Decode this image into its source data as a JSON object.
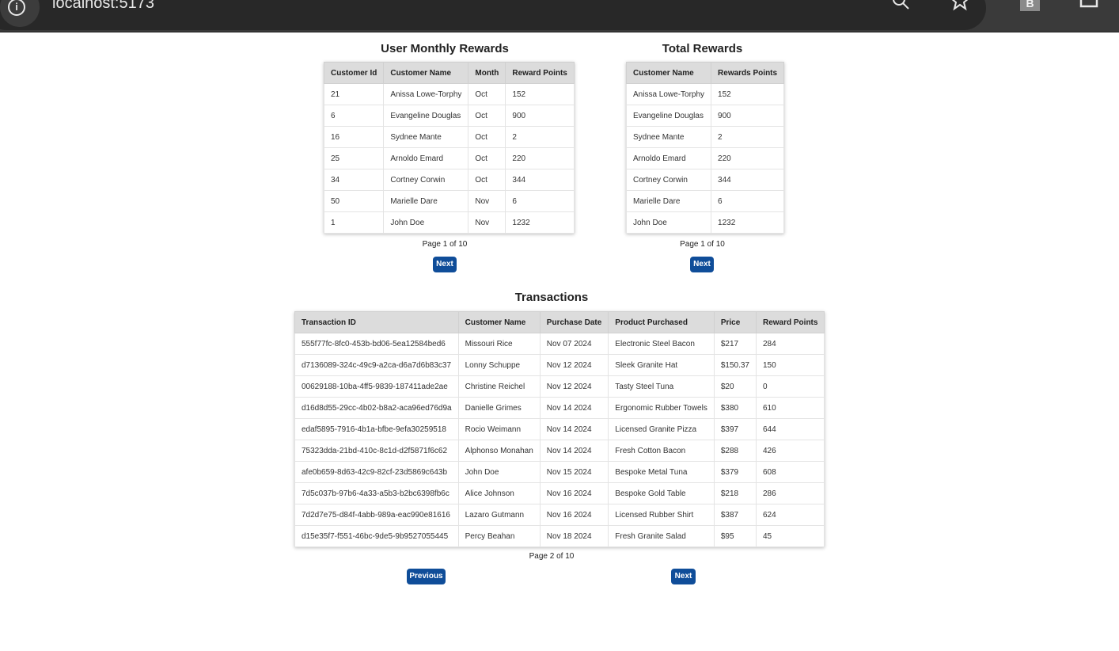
{
  "browser": {
    "url": "localhost:5173",
    "profile_initial": "B"
  },
  "monthly": {
    "title": "User Monthly Rewards",
    "headers": [
      "Customer Id",
      "Customer Name",
      "Month",
      "Reward Points"
    ],
    "rows": [
      [
        "21",
        "Anissa Lowe-Torphy",
        "Oct",
        "152"
      ],
      [
        "6",
        "Evangeline Douglas",
        "Oct",
        "900"
      ],
      [
        "16",
        "Sydnee Mante",
        "Oct",
        "2"
      ],
      [
        "25",
        "Arnoldo Emard",
        "Oct",
        "220"
      ],
      [
        "34",
        "Cortney Corwin",
        "Oct",
        "344"
      ],
      [
        "50",
        "Marielle Dare",
        "Nov",
        "6"
      ],
      [
        "1",
        "John Doe",
        "Nov",
        "1232"
      ]
    ],
    "page_label": "Page 1 of 10",
    "next_label": "Next"
  },
  "total": {
    "title": "Total Rewards",
    "headers": [
      "Customer Name",
      "Rewards Points"
    ],
    "rows": [
      [
        "Anissa Lowe-Torphy",
        "152"
      ],
      [
        "Evangeline Douglas",
        "900"
      ],
      [
        "Sydnee Mante",
        "2"
      ],
      [
        "Arnoldo Emard",
        "220"
      ],
      [
        "Cortney Corwin",
        "344"
      ],
      [
        "Marielle Dare",
        "6"
      ],
      [
        "John Doe",
        "1232"
      ]
    ],
    "page_label": "Page 1 of 10",
    "next_label": "Next"
  },
  "transactions": {
    "title": "Transactions",
    "headers": [
      "Transaction ID",
      "Customer Name",
      "Purchase Date",
      "Product Purchased",
      "Price",
      "Reward Points"
    ],
    "rows": [
      [
        "555f77fc-8fc0-453b-bd06-5ea12584bed6",
        "Missouri Rice",
        "Nov 07 2024",
        "Electronic Steel Bacon",
        "$217",
        "284"
      ],
      [
        "d7136089-324c-49c9-a2ca-d6a7d6b83c37",
        "Lonny Schuppe",
        "Nov 12 2024",
        "Sleek Granite Hat",
        "$150.37",
        "150"
      ],
      [
        "00629188-10ba-4ff5-9839-187411ade2ae",
        "Christine Reichel",
        "Nov 12 2024",
        "Tasty Steel Tuna",
        "$20",
        "0"
      ],
      [
        "d16d8d55-29cc-4b02-b8a2-aca96ed76d9a",
        "Danielle Grimes",
        "Nov 14 2024",
        "Ergonomic Rubber Towels",
        "$380",
        "610"
      ],
      [
        "edaf5895-7916-4b1a-bfbe-9efa30259518",
        "Rocio Weimann",
        "Nov 14 2024",
        "Licensed Granite Pizza",
        "$397",
        "644"
      ],
      [
        "75323dda-21bd-410c-8c1d-d2f5871f6c62",
        "Alphonso Monahan",
        "Nov 14 2024",
        "Fresh Cotton Bacon",
        "$288",
        "426"
      ],
      [
        "afe0b659-8d63-42c9-82cf-23d5869c643b",
        "John Doe",
        "Nov 15 2024",
        "Bespoke Metal Tuna",
        "$379",
        "608"
      ],
      [
        "7d5c037b-97b6-4a33-a5b3-b2bc6398fb6c",
        "Alice Johnson",
        "Nov 16 2024",
        "Bespoke Gold Table",
        "$218",
        "286"
      ],
      [
        "7d2d7e75-d84f-4abb-989a-eac990e81616",
        "Lazaro Gutmann",
        "Nov 16 2024",
        "Licensed Rubber Shirt",
        "$387",
        "624"
      ],
      [
        "d15e35f7-f551-46bc-9de5-9b9527055445",
        "Percy Beahan",
        "Nov 18 2024",
        "Fresh Granite Salad",
        "$95",
        "45"
      ]
    ],
    "page_label": "Page 2 of 10",
    "previous_label": "Previous",
    "next_label": "Next"
  }
}
